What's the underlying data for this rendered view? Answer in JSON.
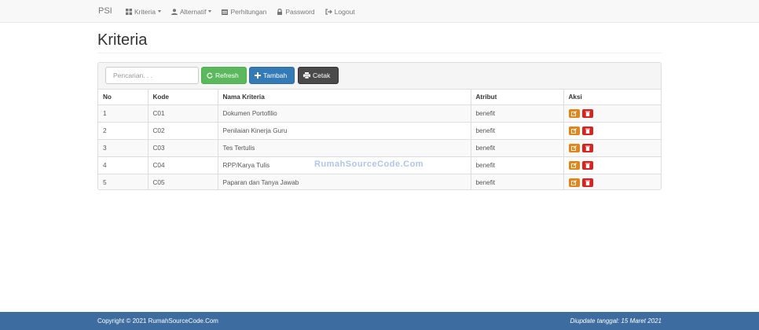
{
  "navbar": {
    "brand": "PSI",
    "items": [
      {
        "label": "Kriteria",
        "icon": "th-large-icon",
        "dropdown": true
      },
      {
        "label": "Alternatif",
        "icon": "user-icon",
        "dropdown": true
      },
      {
        "label": "Perhitungan",
        "icon": "calendar-icon",
        "dropdown": false
      },
      {
        "label": "Password",
        "icon": "lock-icon",
        "dropdown": false
      },
      {
        "label": "Logout",
        "icon": "logout-icon",
        "dropdown": false
      }
    ]
  },
  "page": {
    "title": "Kriteria"
  },
  "toolbar": {
    "search_placeholder": "Pencarian. . .",
    "search_value": "",
    "refresh_label": "Refresh",
    "tambah_label": "Tambah",
    "cetak_label": "Cetak"
  },
  "table": {
    "headers": [
      "No",
      "Kode",
      "Nama Kriteria",
      "Atribut",
      "Aksi"
    ],
    "rows": [
      {
        "no": "1",
        "kode": "C01",
        "nama": "Dokumen Portofilio",
        "atribut": "benefit"
      },
      {
        "no": "2",
        "kode": "C02",
        "nama": "Penilaian Kinerja Guru",
        "atribut": "benefit"
      },
      {
        "no": "3",
        "kode": "C03",
        "nama": "Tes Tertulis",
        "atribut": "benefit"
      },
      {
        "no": "4",
        "kode": "C04",
        "nama": "RPP/Karya Tulis",
        "atribut": "benefit"
      },
      {
        "no": "5",
        "kode": "C05",
        "nama": "Paparan dan Tanya Jawab",
        "atribut": "benefit"
      }
    ]
  },
  "watermark": "RumahSourceCode.Com",
  "footer": {
    "copyright": "Copyright © 2021 RumahSourceCode.Com",
    "updated": "Diupdate tanggal: 15 Maret 2021"
  },
  "colors": {
    "refresh": "#5cb85c",
    "tambah": "#337ab7",
    "cetak": "#4a4a4a",
    "edit": "#e0861b",
    "delete": "#d9231f",
    "footer": "#3d6ca0"
  }
}
